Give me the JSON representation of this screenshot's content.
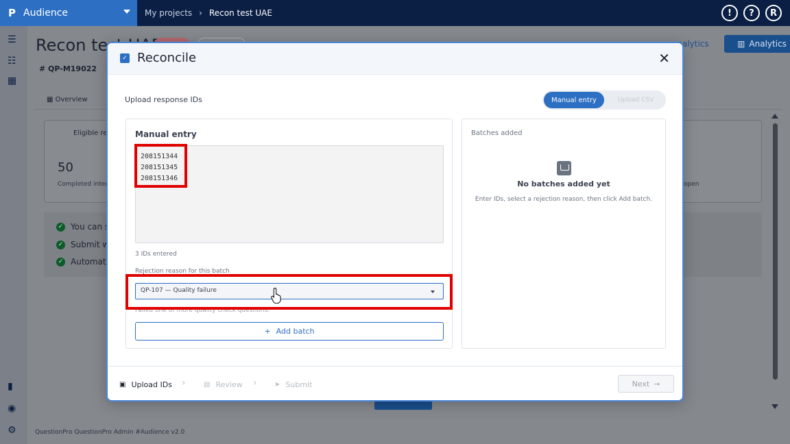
{
  "topbar": {
    "logo": "P",
    "app_name": "Audience",
    "breadcrumb": {
      "link": "My projects",
      "current": "Recon test UAE"
    },
    "icons": [
      "feedback-icon",
      "help-icon",
      "avatar"
    ],
    "avatar_initial": "R"
  },
  "background": {
    "title": "Recon test UAE",
    "project_id": "QP-M19022",
    "analytics_link": "analytics",
    "analytics_button": "Analytics",
    "tab_overview": "Overview",
    "card_heading": "Eligible res",
    "stat_value": "50",
    "stat_label": "Completed inter",
    "stat_open": "open",
    "checks": [
      "You can s",
      "Submit w",
      "Automati"
    ],
    "footer": "QuestionPro QuestionPro Admin  #Audience v2.0"
  },
  "modal": {
    "title": "Reconcile",
    "upload_label": "Upload response IDs",
    "toggle": {
      "manual": "Manual entry",
      "csv": "Upload CSV"
    },
    "manual_entry": {
      "title": "Manual entry",
      "ids": "208151344\n208151345\n208151346",
      "count_text": "3 IDs entered",
      "reason_label": "Rejection reason for this batch",
      "reason_value": "QP-107 — Quality failure",
      "reason_desc": "Failed one or more quality check questions.",
      "add_batch": "Add batch"
    },
    "batches": {
      "title": "Batches added",
      "empty_title": "No batches added yet",
      "empty_desc": "Enter IDs, select a rejection reason, then click Add batch."
    },
    "steps": {
      "upload": "Upload IDs",
      "review": "Review",
      "submit": "Submit"
    },
    "next_button": "Next"
  },
  "colors": {
    "brand_blue": "#2d6fc3",
    "navy": "#0b1f44",
    "annotation_red": "#e10000"
  }
}
